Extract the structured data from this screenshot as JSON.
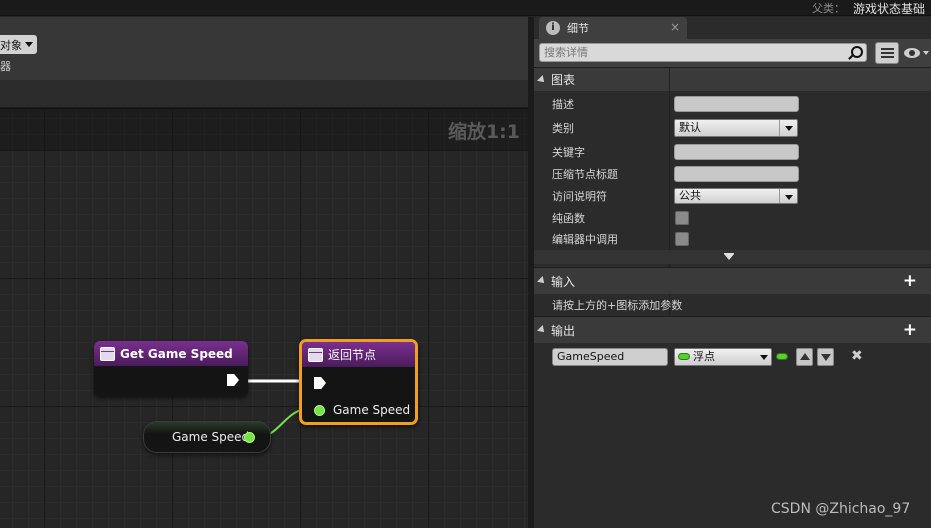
{
  "top": {
    "parent_label": "父类：",
    "parent_value": "游戏状态基础"
  },
  "toolbar": {
    "object_dropdown": "对象",
    "filter_text": "器"
  },
  "graph": {
    "zoom": "缩放1:1",
    "nodes": {
      "get_game_speed": {
        "title": "Get Game Speed"
      },
      "return_node": {
        "title": "返回节点",
        "pin_label": "Game Speed"
      },
      "variable": {
        "label": "Game Speed"
      }
    }
  },
  "details": {
    "tab_title": "细节",
    "tab_close": "×",
    "search_placeholder": "搜索详情",
    "graph_section": {
      "title": "图表",
      "rows": [
        {
          "label": "描述",
          "value": ""
        },
        {
          "label": "类别",
          "value": "默认"
        },
        {
          "label": "关键字",
          "value": ""
        },
        {
          "label": "压缩节点标题",
          "value": ""
        },
        {
          "label": "访问说明符",
          "value": "公共"
        },
        {
          "label": "纯函数",
          "checked": false
        },
        {
          "label": "编辑器中调用",
          "checked": false
        }
      ]
    },
    "inputs_section": {
      "title": "输入",
      "plus": "+",
      "hint": "请按上方的+图标添加参数"
    },
    "outputs_section": {
      "title": "输出",
      "plus": "+",
      "param_name": "GameSpeed",
      "param_type": "浮点",
      "remove": "✖"
    }
  },
  "watermark": "CSDN @Zhichao_97",
  "colors": {
    "function_header": "#6b2a80",
    "selected_border": "#f0a020",
    "float_pin": "#79e04b"
  }
}
